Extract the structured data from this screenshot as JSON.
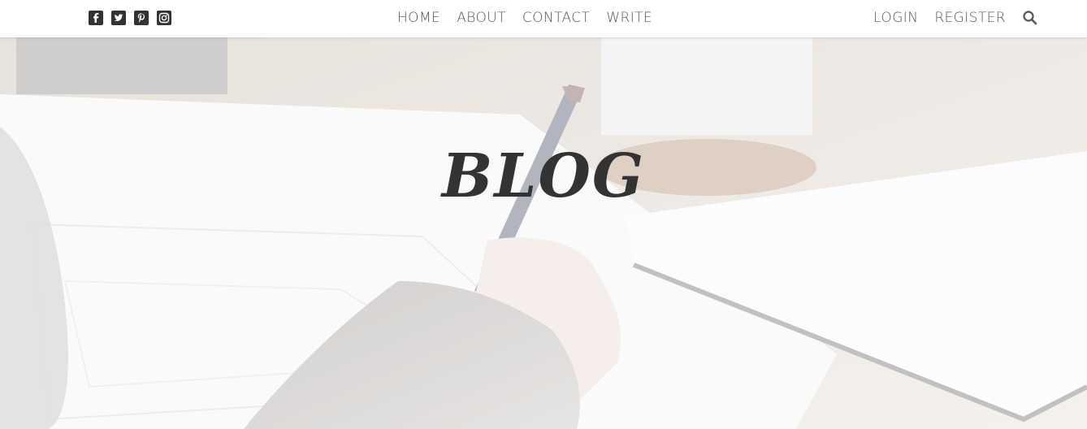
{
  "nav": {
    "social": [
      {
        "name": "facebook-icon"
      },
      {
        "name": "twitter-icon"
      },
      {
        "name": "pinterest-icon"
      },
      {
        "name": "instagram-icon"
      }
    ],
    "main": [
      "HOME",
      "ABOUT",
      "CONTACT",
      "WRITE"
    ],
    "auth": {
      "login": "LOGIN",
      "register": "REGISTER"
    },
    "search_icon": "search-icon"
  },
  "hero": {
    "title": "BLOG"
  },
  "colors": {
    "nav_text": "#555555",
    "icon": "#333333",
    "title": "#333333"
  }
}
